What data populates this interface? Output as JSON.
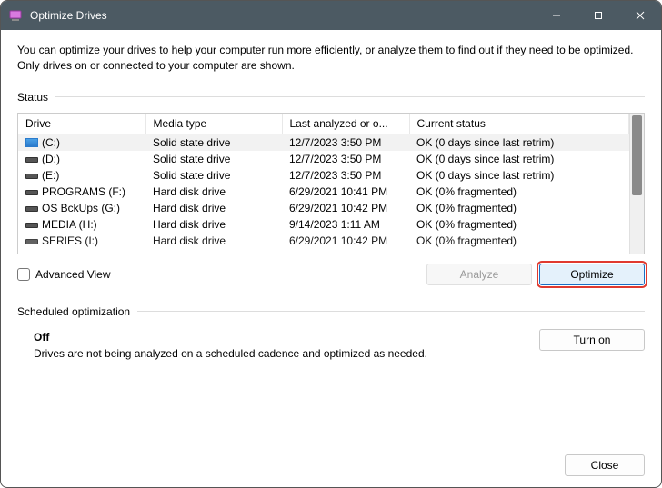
{
  "window": {
    "title": "Optimize Drives"
  },
  "intro": "You can optimize your drives to help your computer run more efficiently, or analyze them to find out if they need to be optimized. Only drives on or connected to your computer are shown.",
  "status_label": "Status",
  "columns": {
    "drive": "Drive",
    "media": "Media type",
    "last": "Last analyzed or o...",
    "status": "Current status"
  },
  "drives": [
    {
      "name": "(C:)",
      "media": "Solid state drive",
      "last": "12/7/2023 3:50 PM",
      "status": "OK (0 days since last retrim)",
      "selected": true,
      "icon": "ssd-sel"
    },
    {
      "name": "(D:)",
      "media": "Solid state drive",
      "last": "12/7/2023 3:50 PM",
      "status": "OK (0 days since last retrim)",
      "icon": "ssd"
    },
    {
      "name": "(E:)",
      "media": "Solid state drive",
      "last": "12/7/2023 3:50 PM",
      "status": "OK (0 days since last retrim)",
      "icon": "ssd"
    },
    {
      "name": "PROGRAMS (F:)",
      "media": "Hard disk drive",
      "last": "6/29/2021 10:41 PM",
      "status": "OK (0% fragmented)",
      "icon": "hdd"
    },
    {
      "name": "OS BckUps (G:)",
      "media": "Hard disk drive",
      "last": "6/29/2021 10:42 PM",
      "status": "OK (0% fragmented)",
      "icon": "hdd"
    },
    {
      "name": "MEDIA (H:)",
      "media": "Hard disk drive",
      "last": "9/14/2023 1:11 AM",
      "status": "OK (0% fragmented)",
      "icon": "hdd"
    },
    {
      "name": "SERIES (I:)",
      "media": "Hard disk drive",
      "last": "6/29/2021 10:42 PM",
      "status": "OK (0% fragmented)",
      "icon": "hdd",
      "cut": true
    }
  ],
  "advanced_view": "Advanced View",
  "buttons": {
    "analyze": "Analyze",
    "optimize": "Optimize",
    "turn_on": "Turn on",
    "close": "Close"
  },
  "scheduled_label": "Scheduled optimization",
  "scheduled": {
    "state": "Off",
    "desc": "Drives are not being analyzed on a scheduled cadence and optimized as needed."
  }
}
